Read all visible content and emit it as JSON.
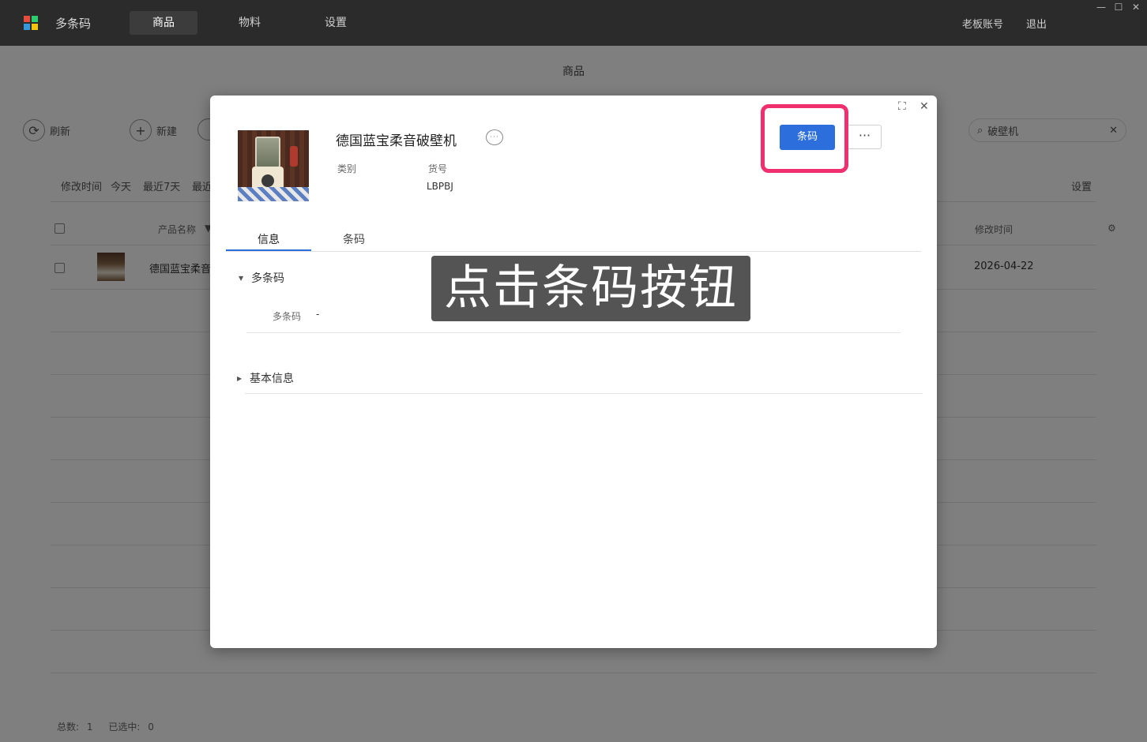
{
  "app": {
    "name": "多条码",
    "logo_colors": [
      "#e74c3c",
      "#2ecc71",
      "#3498db",
      "#f1c40f"
    ]
  },
  "nav": {
    "tabs": [
      "商品",
      "物料",
      "设置"
    ],
    "active_tab": "商品",
    "account": "老板账号",
    "logout": "退出",
    "window_controls": [
      "minimize-icon",
      "maximize-icon",
      "close-icon"
    ]
  },
  "page": {
    "title": "商品",
    "toolbar": {
      "refresh": "刷新",
      "new": "新建"
    },
    "search": {
      "value": "破壁机"
    },
    "filters": {
      "label": "修改时间",
      "options": [
        "今天",
        "最近7天",
        "最近"
      ],
      "settings": "设置"
    },
    "table": {
      "headers": {
        "name": "产品名称",
        "modified": "修改时间"
      },
      "rows": [
        {
          "name": "德国蓝宝柔音",
          "modified": "2026-04-22"
        }
      ]
    },
    "footer": {
      "total_label": "总数:",
      "total": "1",
      "selected_label": "已选中:",
      "selected": "0"
    }
  },
  "dialog": {
    "product_name": "德国蓝宝柔音破壁机",
    "category_label": "类别",
    "category_value": "",
    "sku_label": "货号",
    "sku_value": "LBPBJ",
    "barcode_button": "条码",
    "more_button": "···",
    "tabs": [
      "信息",
      "条码"
    ],
    "active_tab": "信息",
    "sections": [
      {
        "title": "多条码",
        "expanded": true,
        "fields": [
          {
            "label": "多条码",
            "value": "-"
          }
        ]
      },
      {
        "title": "基本信息",
        "expanded": false
      }
    ]
  },
  "caption": "点击条码按钮",
  "colors": {
    "accent": "#2c6fdc",
    "highlight": "#f0306e",
    "titlebar": "#2b2b2b"
  }
}
